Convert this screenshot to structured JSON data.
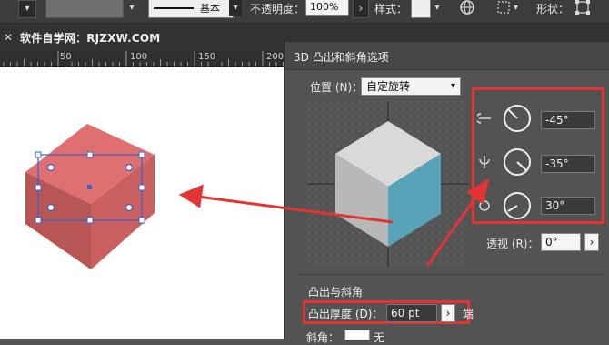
{
  "control_bar": {
    "stroke_weight_label": "基本",
    "opacity_label": "不透明度：",
    "opacity_value": "100%",
    "style_label": "样式：",
    "shape_label": "形状：",
    "icons": {
      "globe": "globe-icon",
      "align": "align-grid-icon",
      "shape": "transform-box-icon"
    }
  },
  "document_tab": {
    "title": "软件自学网：RJZXW.COM"
  },
  "ruler": {
    "labels": [
      "50",
      "100",
      "150",
      "200"
    ]
  },
  "dialog": {
    "title": "3D 凸出和斜角选项",
    "position_label": "位置 (N)：",
    "position_value": "自定旋转",
    "rotation": {
      "x_angle": "-45°",
      "y_angle": "-35°",
      "z_angle": "30°"
    },
    "perspective_label": "透视 (R)：",
    "perspective_value": "0°",
    "extrude_section_title": "凸出与斜角",
    "extrude_depth_label": "凸出厚度 (D)：",
    "extrude_depth_value": "60 pt",
    "extrude_extra_glyph": "端",
    "bevel_label": "斜角：",
    "bevel_value": "无"
  },
  "colors": {
    "cube_top": "#e06f6f",
    "cube_left": "#b85656",
    "cube_right": "#d46565",
    "preview_top": "#d9d9d9",
    "preview_left": "#b8b8b8",
    "preview_right": "#57a3b8",
    "highlight": "#e23434",
    "selection": "#3563d6"
  }
}
